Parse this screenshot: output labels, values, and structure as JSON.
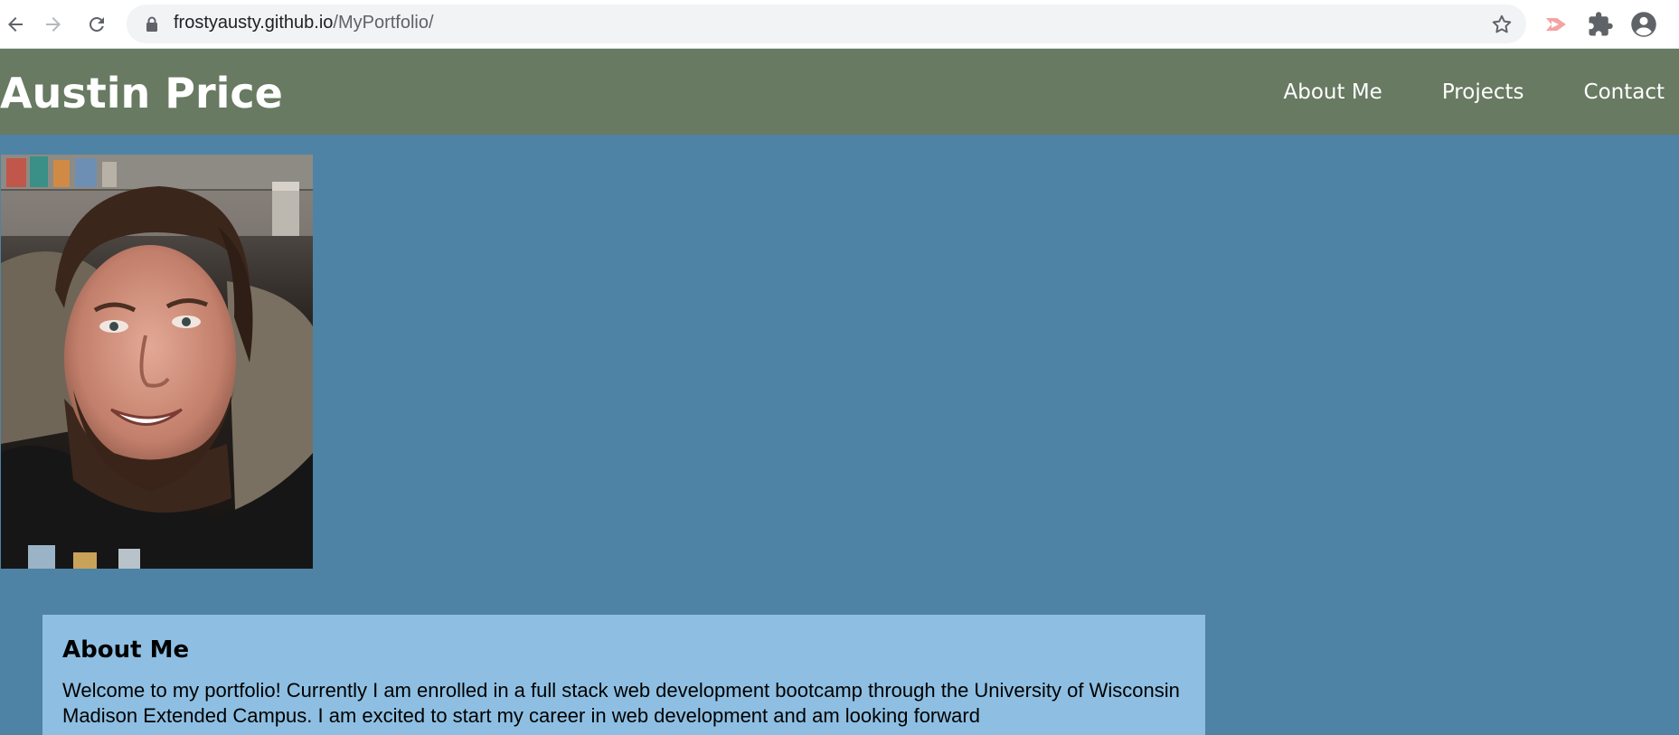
{
  "browser": {
    "url_host": "frostyausty.github.io",
    "url_path": "/MyPortfolio/",
    "icons": [
      "back-icon",
      "forward-icon",
      "reload-icon",
      "lock-icon",
      "star-icon",
      "extension-icon",
      "puzzle-icon",
      "profile-icon"
    ]
  },
  "header": {
    "title": "Austin Price",
    "nav": [
      {
        "label": "About Me"
      },
      {
        "label": "Projects"
      },
      {
        "label": "Contact"
      }
    ]
  },
  "about": {
    "heading": "About Me",
    "body": "Welcome to my portfolio! Currently I am enrolled in a full stack web development bootcamp through the University of Wisconsin Madison Extended Campus. I am excited to start my career in web development and am looking forward"
  },
  "colors": {
    "header_bg": "#687a62",
    "page_bg": "#4e83a5",
    "about_bg": "#8ebfe2"
  }
}
